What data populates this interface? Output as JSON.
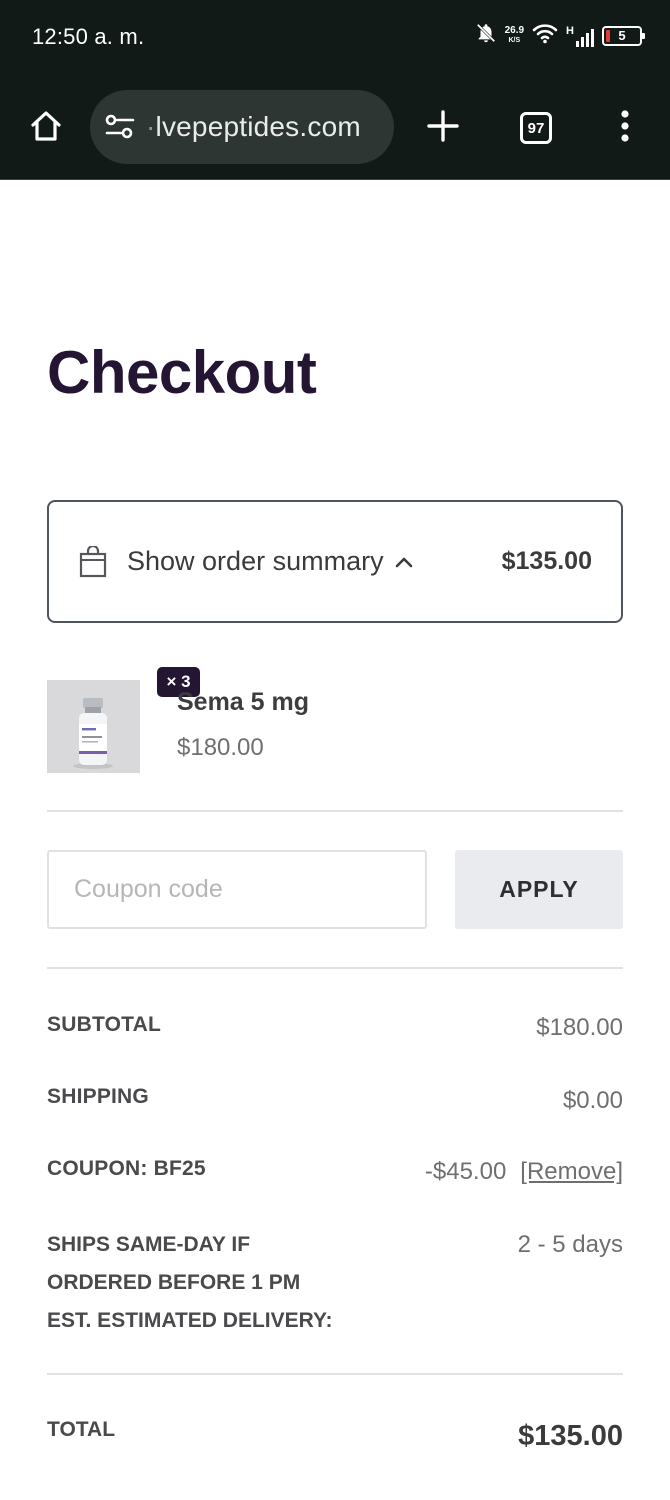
{
  "status_bar": {
    "time": "12:50 a. m.",
    "net_speed": "26.9",
    "net_speed_unit": "K/S",
    "network_type": "H",
    "battery_level": "5"
  },
  "browser": {
    "url_hidden_prefix": "·",
    "url": "lvepeptides.com",
    "tab_count": "97"
  },
  "page": {
    "title": "Checkout"
  },
  "order_summary": {
    "toggle_label": "Show order summary",
    "total": "$135.00"
  },
  "cart_items": [
    {
      "name": "Sema 5 mg",
      "price": "$180.00",
      "quantity_badge": "× 3"
    }
  ],
  "coupon": {
    "placeholder": "Coupon code",
    "apply_label": "APPLY"
  },
  "totals": {
    "subtotal_label": "SUBTOTAL",
    "subtotal_value": "$180.00",
    "shipping_label": "SHIPPING",
    "shipping_value": "$0.00",
    "coupon_label": "COUPON: BF25",
    "coupon_value": "-$45.00",
    "remove_label": "[Remove]",
    "delivery_line1": "SHIPS SAME-DAY IF",
    "delivery_line2": "ORDERED BEFORE 1 PM",
    "delivery_line3": "EST. ESTIMATED DELIVERY:",
    "delivery_value": "2 - 5 days",
    "total_label": "TOTAL",
    "total_value": "$135.00"
  },
  "colors": {
    "browser_chrome": "#121a17",
    "heading": "#241533",
    "badge": "#241533",
    "apply_button_bg": "#e9ebee"
  },
  "icons": [
    "bell-off-icon",
    "wifi-icon",
    "signal-icon",
    "battery-icon",
    "home-icon",
    "site-settings-icon",
    "new-tab-icon",
    "tab-switcher-icon",
    "more-menu-icon",
    "shopping-bag-icon",
    "chevron-up-icon"
  ]
}
